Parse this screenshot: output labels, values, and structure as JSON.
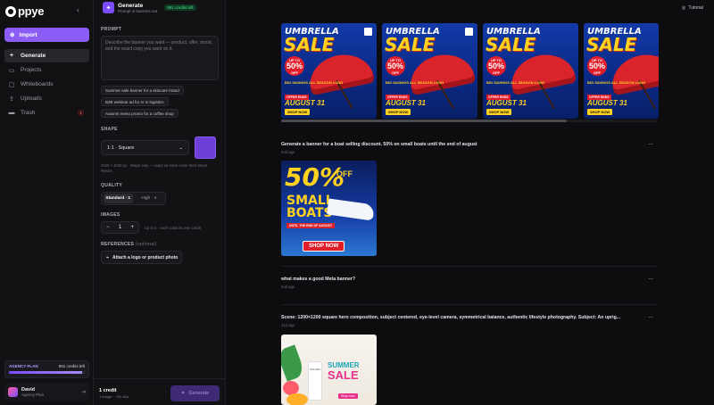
{
  "app": {
    "logo_text": "ppye"
  },
  "sidebar": {
    "import_label": "Import",
    "items": [
      {
        "label": "Generate",
        "icon": "plus-icon"
      },
      {
        "label": "Projects",
        "icon": "folder-icon"
      },
      {
        "label": "Whiteboards",
        "icon": "whiteboard-icon"
      },
      {
        "label": "Uploads",
        "icon": "upload-icon"
      },
      {
        "label": "Trash",
        "icon": "trash-icon",
        "badge": "1"
      }
    ],
    "plan": {
      "name": "AGENCY PLAN",
      "credits": "991 credits left",
      "progress_fraction": 0.97
    },
    "user": {
      "name": "David",
      "plan": "Agency Plan"
    }
  },
  "panel": {
    "title": "Generate",
    "subtitle": "Prompt in banners out",
    "credits_pill": "991 credits left",
    "prompt_label": "PROMPT",
    "prompt_placeholder": "Describe the banner you want — product, offer, mood, and the exact copy you want on it.",
    "suggestions": [
      "Summer sale banner for a skincare brand",
      "B2B webinar ad for AI in logistics",
      "Autumn menu promo for a coffee shop"
    ],
    "shape_label": "SHAPE",
    "shape_value": "1:1 · Square",
    "shape_hint": "1040 × 1040 px · shape only — exact ad sizes come from Smart Resize.",
    "quality_label": "QUALITY",
    "quality_options": [
      "Standard · 1",
      "High · 4"
    ],
    "images_label": "IMAGES",
    "images_count": "1",
    "images_hint": "Up to 4 · each costs its own credit",
    "references_label": "REFERENCES",
    "references_optional": "(optional)",
    "attach_label": "Attach a logo or product photo",
    "footer_credit": "1 credit",
    "footer_sub": "1 image · ~30–60s",
    "generate_label": "Generate"
  },
  "main": {
    "tutorial_label": "Tutorial",
    "umbrella_banner": {
      "line1": "UMBRELLA",
      "line2": "SALE",
      "upto": "UP TO",
      "pct": "50%",
      "off": "OFF",
      "big": "BIG SAVINGS ALL SEASON LONG",
      "ends": "OFFER ENDS",
      "date": "AUGUST 31",
      "shop": "SHOP NOW"
    },
    "entries": [
      {
        "text": "Generate a banner for a boat selling discount. 50% on small boats until the end of august",
        "time": "2nd ago"
      },
      {
        "text": "what makes a good Meta banner?",
        "time": "2nd ago"
      },
      {
        "text": "Scene: 1200×1200 square hero composition, subject centered, eye-level camera, symmetrical balance, authentic lifestyle photography. Subject: An uprig...",
        "time": "41d ago"
      }
    ],
    "boat_banner": {
      "pct": "50%",
      "off": "OFF",
      "small": "SMALL",
      "boats": "BOATS",
      "until": "UNTIL THE END OF AUGUST",
      "shop": "SHOP NOW"
    },
    "summer_banner": {
      "s1": "SUMMER",
      "s2": "SALE",
      "brand": "SOLARA",
      "btn": "Shop now"
    }
  }
}
